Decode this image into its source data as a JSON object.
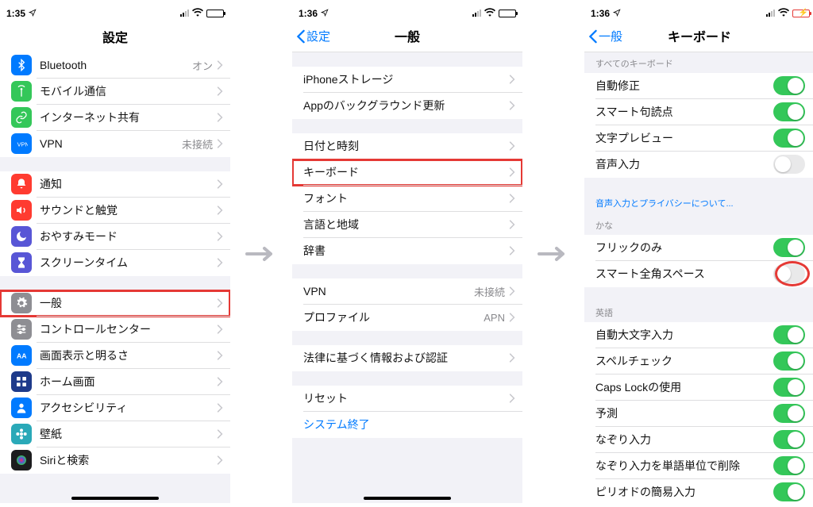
{
  "arrow_color": "#b9b9c0",
  "screens": [
    {
      "status": {
        "time": "1:35",
        "battery_style": "normal"
      },
      "nav": {
        "title": "設定",
        "back": null
      },
      "groups": [
        {
          "header": null,
          "rows": [
            {
              "icon": "bluetooth-icon",
              "icon_bg": "bg-blue",
              "label": "Bluetooth",
              "value": "オン",
              "kind": "chevron"
            },
            {
              "icon": "antenna-icon",
              "icon_bg": "bg-green",
              "label": "モバイル通信",
              "value": "",
              "kind": "chevron"
            },
            {
              "icon": "link-icon",
              "icon_bg": "bg-green",
              "label": "インターネット共有",
              "value": "",
              "kind": "chevron"
            },
            {
              "icon": "vpn-icon",
              "icon_bg": "bg-blue",
              "label": "VPN",
              "value": "未接続",
              "kind": "chevron"
            }
          ]
        },
        {
          "header": null,
          "rows": [
            {
              "icon": "bell-icon",
              "icon_bg": "bg-red",
              "label": "通知",
              "value": "",
              "kind": "chevron"
            },
            {
              "icon": "speaker-icon",
              "icon_bg": "bg-red",
              "label": "サウンドと触覚",
              "value": "",
              "kind": "chevron"
            },
            {
              "icon": "moon-icon",
              "icon_bg": "bg-purple",
              "label": "おやすみモード",
              "value": "",
              "kind": "chevron"
            },
            {
              "icon": "hourglass-icon",
              "icon_bg": "bg-purple",
              "label": "スクリーンタイム",
              "value": "",
              "kind": "chevron"
            }
          ]
        },
        {
          "header": null,
          "rows": [
            {
              "icon": "gear-icon",
              "icon_bg": "bg-gray",
              "label": "一般",
              "value": "",
              "kind": "chevron",
              "highlight": true
            },
            {
              "icon": "sliders-icon",
              "icon_bg": "bg-gray",
              "label": "コントロールセンター",
              "value": "",
              "kind": "chevron"
            },
            {
              "icon": "aa-icon",
              "icon_bg": "bg-blue",
              "label": "画面表示と明るさ",
              "value": "",
              "kind": "chevron"
            },
            {
              "icon": "grid-icon",
              "icon_bg": "bg-dblue",
              "label": "ホーム画面",
              "value": "",
              "kind": "chevron"
            },
            {
              "icon": "person-icon",
              "icon_bg": "bg-blue",
              "label": "アクセシビリティ",
              "value": "",
              "kind": "chevron"
            },
            {
              "icon": "flower-icon",
              "icon_bg": "bg-teal",
              "label": "壁紙",
              "value": "",
              "kind": "chevron"
            },
            {
              "icon": "siri-icon",
              "icon_bg": "bg-black",
              "label": "Siriと検索",
              "value": "",
              "kind": "chevron"
            }
          ]
        }
      ],
      "home_indicator": true
    },
    {
      "status": {
        "time": "1:36",
        "battery_style": "normal"
      },
      "nav": {
        "title": "一般",
        "back": "設定"
      },
      "groups": [
        {
          "header": null,
          "mt": true,
          "rows": [
            {
              "label": "iPhoneストレージ",
              "value": "",
              "kind": "chevron"
            },
            {
              "label": "Appのバックグラウンド更新",
              "value": "",
              "kind": "chevron"
            }
          ]
        },
        {
          "header": null,
          "rows": [
            {
              "label": "日付と時刻",
              "value": "",
              "kind": "chevron"
            },
            {
              "label": "キーボード",
              "value": "",
              "kind": "chevron",
              "highlight": true
            },
            {
              "label": "フォント",
              "value": "",
              "kind": "chevron"
            },
            {
              "label": "言語と地域",
              "value": "",
              "kind": "chevron"
            },
            {
              "label": "辞書",
              "value": "",
              "kind": "chevron"
            }
          ]
        },
        {
          "header": null,
          "rows": [
            {
              "label": "VPN",
              "value": "未接続",
              "kind": "chevron"
            },
            {
              "label": "プロファイル",
              "value": "APN",
              "kind": "chevron"
            }
          ]
        },
        {
          "header": null,
          "rows": [
            {
              "label": "法律に基づく情報および認証",
              "value": "",
              "kind": "chevron"
            }
          ]
        },
        {
          "header": null,
          "rows": [
            {
              "label": "リセット",
              "value": "",
              "kind": "chevron"
            },
            {
              "label": "システム終了",
              "value": "",
              "kind": "link"
            }
          ]
        }
      ],
      "home_indicator": true
    },
    {
      "status": {
        "time": "1:36",
        "battery_style": "red_charge"
      },
      "nav": {
        "title": "キーボード",
        "back": "一般"
      },
      "groups": [
        {
          "header": "すべてのキーボード",
          "rows": [
            {
              "label": "自動修正",
              "kind": "toggle",
              "on": true
            },
            {
              "label": "スマート句読点",
              "kind": "toggle",
              "on": true
            },
            {
              "label": "文字プレビュー",
              "kind": "toggle",
              "on": true
            },
            {
              "label": "音声入力",
              "kind": "toggle",
              "on": false
            }
          ],
          "footer": "音声入力とプライバシーについて..."
        },
        {
          "header": "かな",
          "rows": [
            {
              "label": "フリックのみ",
              "kind": "toggle",
              "on": true
            },
            {
              "label": "スマート全角スペース",
              "kind": "toggle",
              "on": false,
              "highlight_toggle": true
            }
          ]
        },
        {
          "header": "英語",
          "rows": [
            {
              "label": "自動大文字入力",
              "kind": "toggle",
              "on": true
            },
            {
              "label": "スペルチェック",
              "kind": "toggle",
              "on": true
            },
            {
              "label": "Caps Lockの使用",
              "kind": "toggle",
              "on": true
            },
            {
              "label": "予測",
              "kind": "toggle",
              "on": true
            },
            {
              "label": "なぞり入力",
              "kind": "toggle",
              "on": true
            },
            {
              "label": "なぞり入力を単語単位で削除",
              "kind": "toggle",
              "on": true
            },
            {
              "label": "ピリオドの簡易入力",
              "kind": "toggle",
              "on": true
            }
          ]
        }
      ],
      "home_indicator": false
    }
  ]
}
